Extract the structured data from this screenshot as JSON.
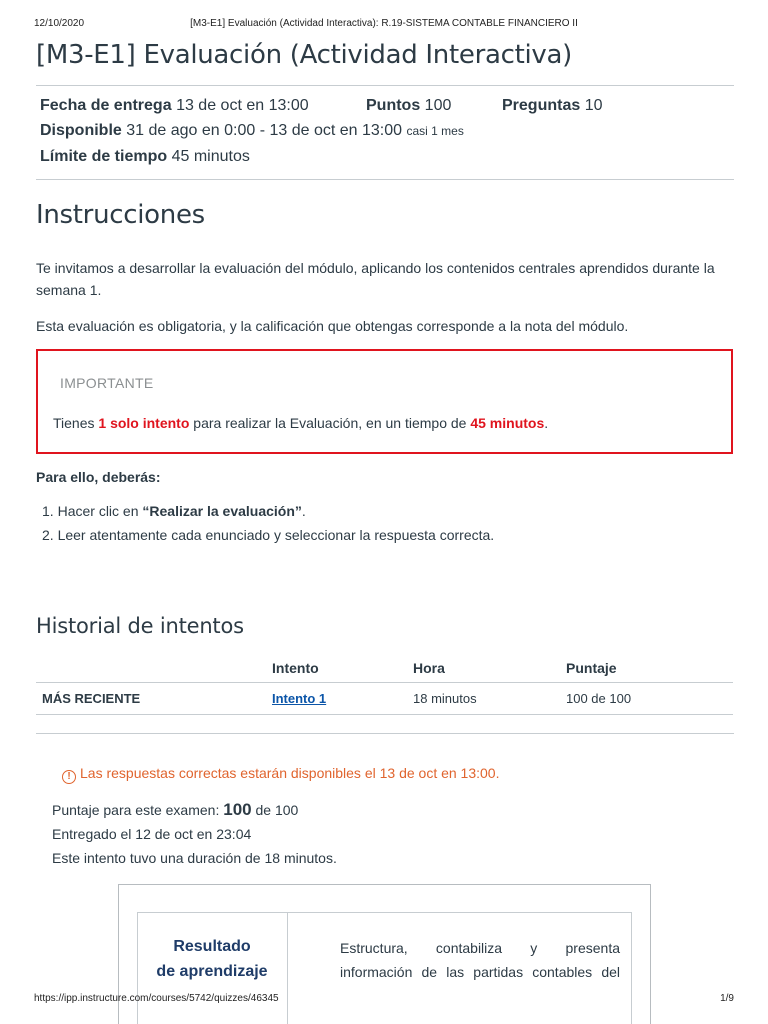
{
  "print_header": {
    "date": "12/10/2020",
    "title": "[M3-E1] Evaluación (Actividad Interactiva): R.19-SISTEMA CONTABLE FINANCIERO II"
  },
  "quiz": {
    "title": "[M3-E1] Evaluación (Actividad Interactiva)",
    "due_label": "Fecha de entrega",
    "due_value": "13 de oct en 13:00",
    "points_label": "Puntos",
    "points_value": "100",
    "questions_label": "Preguntas",
    "questions_value": "10",
    "available_label": "Disponible",
    "available_value": "31 de ago en 0:00 - 13 de oct en 13:00",
    "available_note": "casi 1 mes",
    "time_limit_label": "Límite de tiempo",
    "time_limit_value": "45 minutos"
  },
  "instructions": {
    "heading": "Instrucciones",
    "p1": "Te invitamos a desarrollar la evaluación del módulo, aplicando los contenidos centrales aprendidos durante la semana 1.",
    "p2": "Esta evaluación es obligatoria, y la calificación que obtengas corresponde a la nota del módulo.",
    "important_label": "IMPORTANTE",
    "important_pre": "Tienes ",
    "important_attempts": "1 solo intento",
    "important_mid": " para realizar la Evaluación, en un tiempo de ",
    "important_time": "45 minutos",
    "important_end": ".",
    "steps_heading": "Para ello, deberás:",
    "step1_num": "1.",
    "step1_pre": "Hacer clic en ",
    "step1_bold": "“Realizar la evaluación”",
    "step1_end": ".",
    "step2_num": "2.",
    "step2": "Leer atentamente cada enunciado y seleccionar la respuesta correcta."
  },
  "history": {
    "heading": "Historial de intentos",
    "columns": [
      "",
      "Intento",
      "Hora",
      "Puntaje"
    ],
    "rows": [
      {
        "label": "MÁS RECIENTE",
        "attempt": "Intento 1 ",
        "time": "18 minutos",
        "score": "100 de 100"
      }
    ]
  },
  "result": {
    "warning_icon": "!",
    "warning": "Las respuestas correctas estarán disponibles el 13 de oct en 13:00.",
    "score_pre": "Puntaje para este examen: ",
    "score_value": "100",
    "score_post": " de 100",
    "submitted": "Entregado el 12 de oct en 23:04",
    "duration": "Este intento tuvo una duración de 18 minutos.",
    "outcome_label_line1": "Resultado",
    "outcome_label_line2": "de aprendizaje",
    "outcome_text_line1": "Estructura, contabiliza y presenta",
    "outcome_text_line2": "información de las partidas contables del"
  },
  "print_footer": {
    "url": "https://ipp.instructure.com/courses/5742/quizzes/46345",
    "page": "1/9"
  },
  "colors": {
    "text": "#2d3b45",
    "red": "#e0141e",
    "warning": "#e0642e",
    "link": "#0b55a8",
    "outcome_label": "#1f3c68"
  }
}
